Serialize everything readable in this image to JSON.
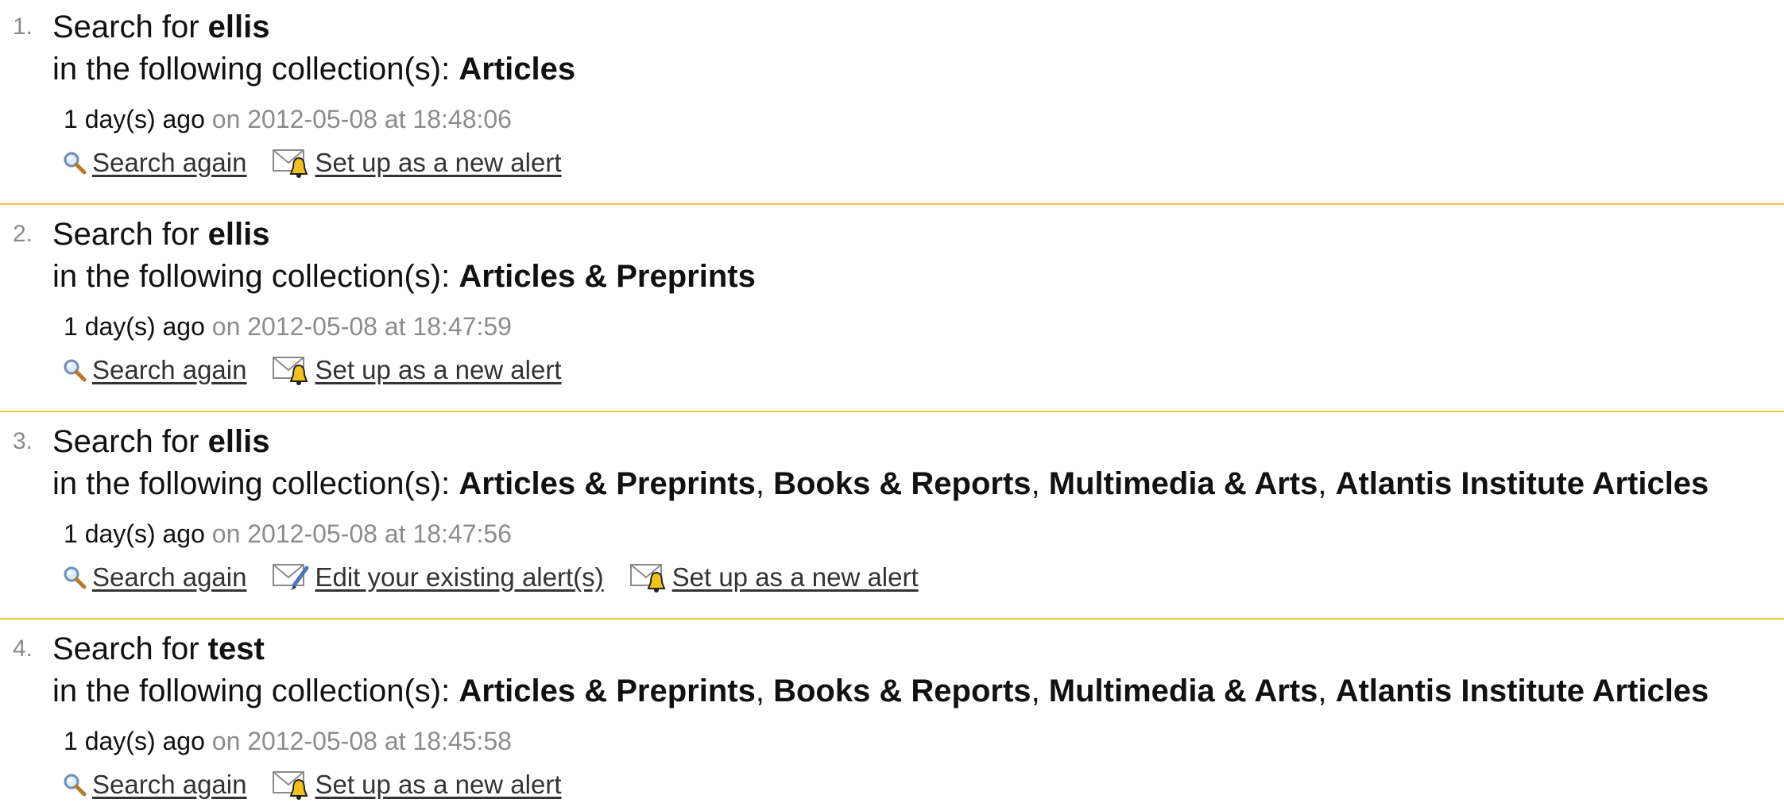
{
  "common": {
    "search_for_prefix": "Search for",
    "collections_prefix": "in the following collection(s):",
    "search_again_label": "Search again",
    "new_alert_label": "Set up as a new alert",
    "edit_alerts_label": "Edit your existing alert(s)",
    "on_word": "on",
    "at_word": "at"
  },
  "colors": {
    "divider": "#f3c33b",
    "muted": "#8c8c8c",
    "alert_bell": "#f2c11b"
  },
  "icons": {
    "search": "magnifier-icon",
    "alert": "envelope-bell-icon",
    "edit": "envelope-pencil-icon"
  },
  "entries": [
    {
      "number": "1.",
      "query": "ellis",
      "collections": [
        "Articles"
      ],
      "ago": "1 day(s) ago",
      "date": "2012-05-08",
      "time": "18:48:06",
      "has_edit": false
    },
    {
      "number": "2.",
      "query": "ellis",
      "collections": [
        "Articles & Preprints"
      ],
      "ago": "1 day(s) ago",
      "date": "2012-05-08",
      "time": "18:47:59",
      "has_edit": false
    },
    {
      "number": "3.",
      "query": "ellis",
      "collections": [
        "Articles & Preprints",
        "Books & Reports",
        "Multimedia & Arts",
        "Atlantis Institute Articles"
      ],
      "ago": "1 day(s) ago",
      "date": "2012-05-08",
      "time": "18:47:56",
      "has_edit": true
    },
    {
      "number": "4.",
      "query": "test",
      "collections": [
        "Articles & Preprints",
        "Books & Reports",
        "Multimedia & Arts",
        "Atlantis Institute Articles"
      ],
      "ago": "1 day(s) ago",
      "date": "2012-05-08",
      "time": "18:45:58",
      "has_edit": false
    }
  ]
}
